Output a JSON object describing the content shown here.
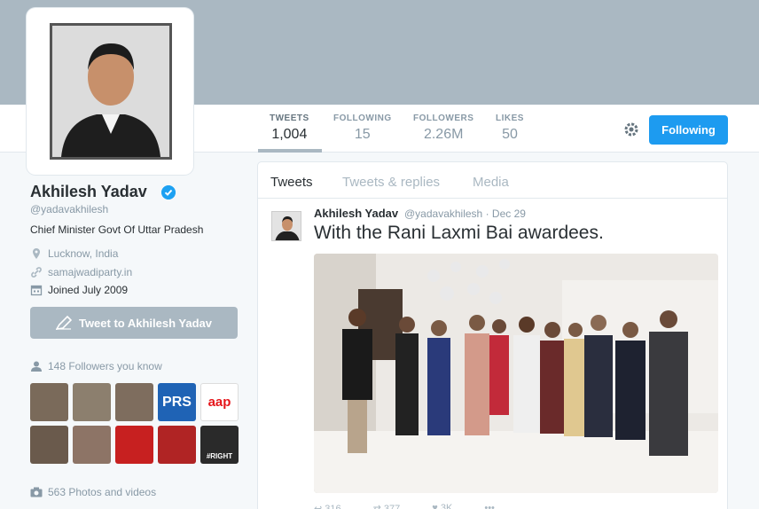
{
  "profile": {
    "name": "Akhilesh Yadav",
    "handle": "@yadavakhilesh",
    "bio": "Chief Minister Govt Of Uttar Pradesh",
    "location": "Lucknow, India",
    "website": "samajwadiparty.in",
    "joined": "Joined July 2009",
    "tweet_to_label": "Tweet to Akhilesh Yadav",
    "followers_you_know": "148 Followers you know",
    "photos_videos": "563 Photos and videos"
  },
  "stats": [
    {
      "label": "TWEETS",
      "value": "1,004"
    },
    {
      "label": "FOLLOWING",
      "value": "15"
    },
    {
      "label": "FOLLOWERS",
      "value": "2.26M"
    },
    {
      "label": "LIKES",
      "value": "50"
    }
  ],
  "follow_button": "Following",
  "tabs": [
    "Tweets",
    "Tweets & replies",
    "Media"
  ],
  "tweet": {
    "name": "Akhilesh Yadav",
    "handle": "@yadavakhilesh",
    "sep": "·",
    "date": "Dec 29",
    "text": "With the Rani Laxmi Bai awardees.",
    "reply": "316",
    "retweets": "377",
    "likes": "3K",
    "more": "•••"
  },
  "known_followers": [
    {
      "label": ""
    },
    {
      "label": ""
    },
    {
      "label": ""
    },
    {
      "label": "PRS"
    },
    {
      "label": "aap"
    },
    {
      "label": ""
    },
    {
      "label": ""
    },
    {
      "label": ""
    },
    {
      "label": ""
    },
    {
      "label": "#RIGHT"
    }
  ],
  "colors": {
    "accent": "#1d9bf0",
    "banner": "#aab8c2",
    "background": "#f5f8fa"
  }
}
